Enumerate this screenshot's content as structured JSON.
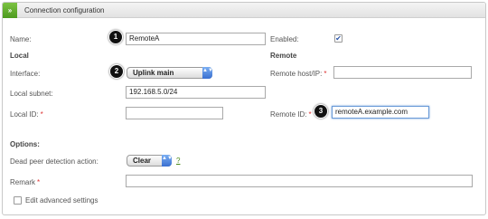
{
  "header": {
    "toggle_label": "»",
    "title": "Connection configuration"
  },
  "form": {
    "name_label": "Name:",
    "name_value": "RemoteA",
    "enabled_label": "Enabled:",
    "enabled_check": "✔",
    "local_heading": "Local",
    "remote_heading": "Remote",
    "interface_label": "Interface:",
    "interface_value": "Uplink main",
    "remote_host_label": "Remote host/IP:",
    "local_subnet_label": "Local subnet:",
    "local_subnet_value": "192.168.5.0/24",
    "local_id_label": "Local ID:",
    "remote_id_label": "Remote ID:",
    "remote_id_value": "remoteA.example.com",
    "options_heading": "Options:",
    "dpd_label": "Dead peer detection action:",
    "dpd_value": "Clear",
    "help_label": "?",
    "remark_label": "Remark",
    "advanced_label": "Edit advanced settings",
    "required_marker": "*"
  },
  "callouts": [
    "1",
    "2",
    "3"
  ],
  "select_arrow": "▲▼",
  "colors": {
    "accent_green": "#5fab2b",
    "focus_blue": "#6a9bd8",
    "required_red": "#d33333"
  }
}
